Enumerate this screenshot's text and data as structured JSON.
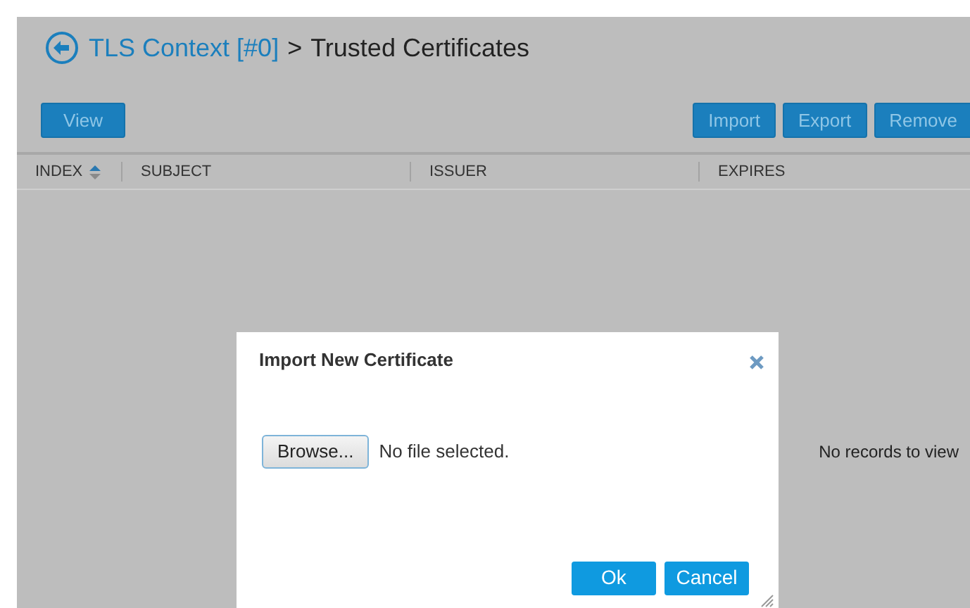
{
  "breadcrumb": {
    "parent": "TLS Context [#0]",
    "separator": ">",
    "current": "Trusted Certificates"
  },
  "toolbar": {
    "left": [
      "View"
    ],
    "right": [
      "Import",
      "Export",
      "Remove"
    ]
  },
  "table": {
    "columns": [
      {
        "label": "INDEX",
        "sorted": true
      },
      {
        "label": "SUBJECT",
        "sorted": false
      },
      {
        "label": "ISSUER",
        "sorted": false
      },
      {
        "label": "EXPIRES",
        "sorted": false
      }
    ],
    "empty_message": "No records to view"
  },
  "dialog": {
    "title": "Import New Certificate",
    "browse_button": "Browse...",
    "file_status": "No file selected.",
    "buttons": [
      "Ok",
      "Cancel"
    ]
  }
}
